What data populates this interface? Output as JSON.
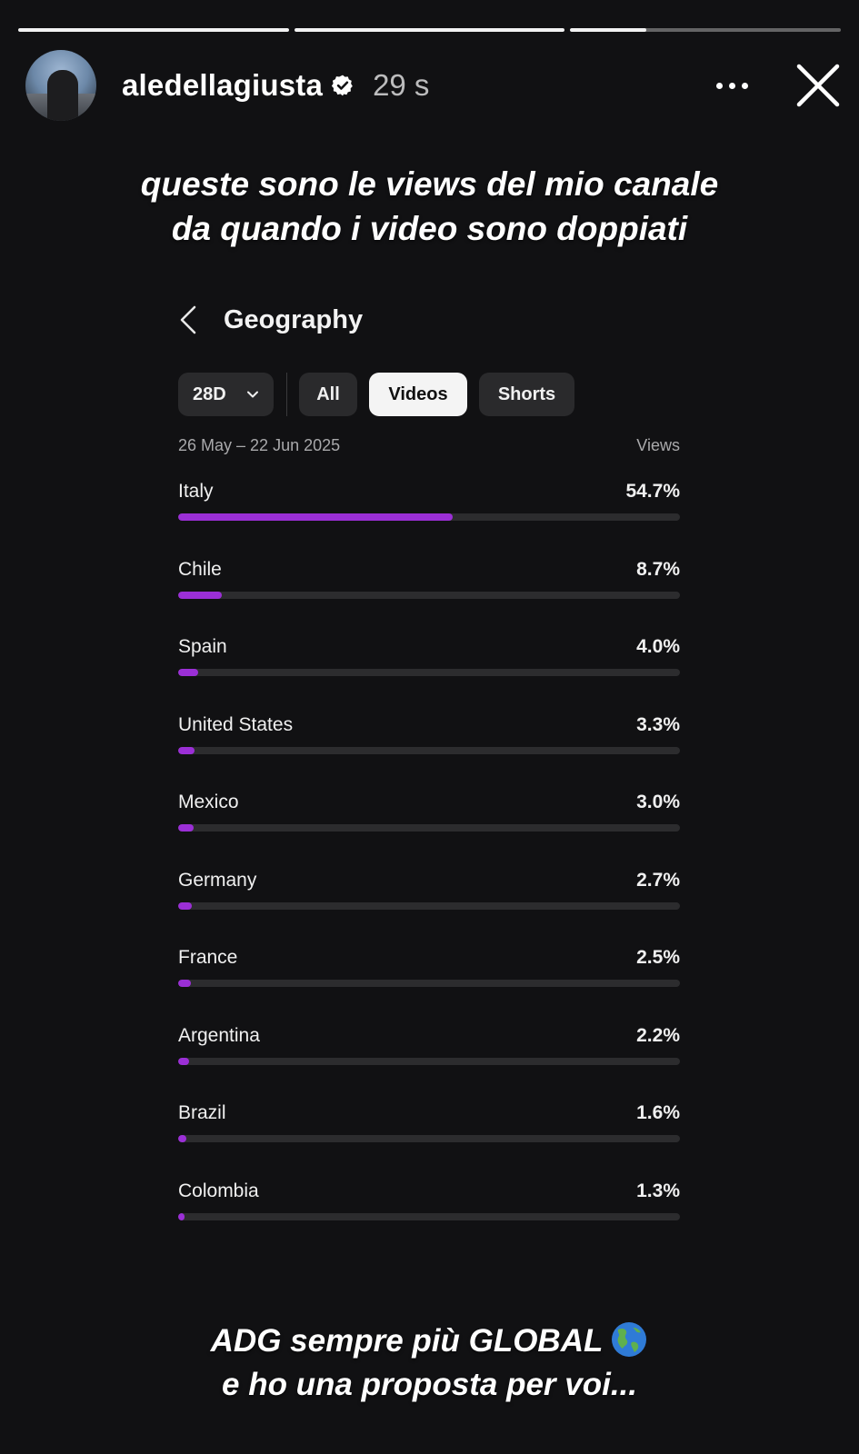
{
  "story": {
    "username": "aledellagiusta",
    "timestamp": "29 s",
    "progress": [
      1,
      1,
      0.28
    ],
    "caption_top": [
      "queste sono le views del mio canale",
      "da quando i video sono doppiati"
    ],
    "caption_bottom": [
      "ADG sempre più GLOBAL",
      "e ho una proposta per voi..."
    ],
    "icons": {
      "verified": "verified-badge-icon",
      "more": "more-options-icon",
      "close": "close-icon",
      "globe": "globe-americas-emoji"
    }
  },
  "panel": {
    "title": "Geography",
    "filters": {
      "period": "28D",
      "tabs": [
        "All",
        "Videos",
        "Shorts"
      ],
      "active_tab": "Videos"
    },
    "date_range": "26 May – 22 Jun 2025",
    "metric_label": "Views",
    "accent_color": "#9b2fd6"
  },
  "chart_data": {
    "type": "bar",
    "categories": [
      "Italy",
      "Chile",
      "Spain",
      "United States",
      "Mexico",
      "Germany",
      "France",
      "Argentina",
      "Brazil",
      "Colombia"
    ],
    "values": [
      54.7,
      8.7,
      4.0,
      3.3,
      3.0,
      2.7,
      2.5,
      2.2,
      1.6,
      1.3
    ],
    "value_labels": [
      "54.7%",
      "8.7%",
      "4.0%",
      "3.3%",
      "3.0%",
      "2.7%",
      "2.5%",
      "2.2%",
      "1.6%",
      "1.3%"
    ],
    "title": "Geography",
    "ylabel": "Views",
    "ylim": [
      0,
      100
    ],
    "orientation": "horizontal"
  }
}
